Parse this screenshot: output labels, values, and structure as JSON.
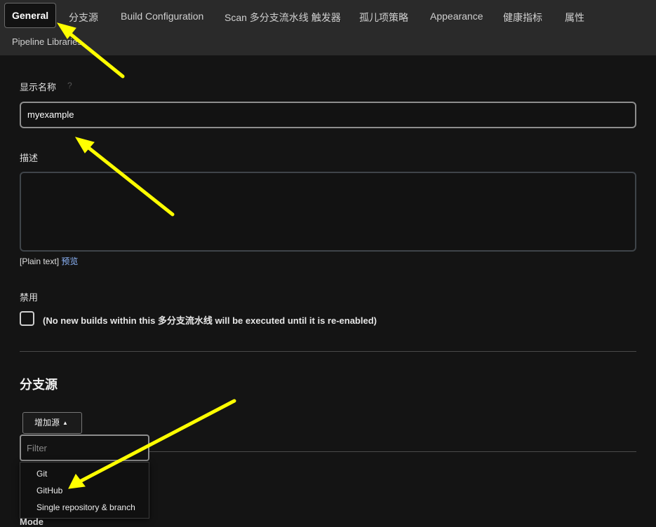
{
  "tabs": [
    {
      "label": "General",
      "active": true
    },
    {
      "label": "分支源"
    },
    {
      "label": "Build Configuration"
    },
    {
      "label": "Scan 多分支流水线 触发器"
    },
    {
      "label": "孤儿项策略"
    },
    {
      "label": "Appearance"
    },
    {
      "label": "健康指标"
    },
    {
      "label": "属性"
    },
    {
      "label": "Pipeline Libraries"
    }
  ],
  "general": {
    "display_name_label": "显示名称",
    "help_icon": "?",
    "display_name_value": "myexample",
    "description_label": "描述",
    "plain_text_label": "[Plain text]",
    "preview_link": "预览",
    "disable_label": "禁用",
    "disable_checkbox_text": "(No new builds within this 多分支流水线 will be executed until it is re-enabled)",
    "disable_checked": false
  },
  "branch_sources": {
    "title": "分支源",
    "add_source_button": "增加源",
    "add_source_caret": "▲",
    "filter_placeholder": "Filter",
    "menu_items": [
      "Git",
      "GitHub",
      "Single repository & branch"
    ],
    "next_label": "Mode"
  },
  "annotation": {
    "arrow_color": "#ffff00"
  }
}
